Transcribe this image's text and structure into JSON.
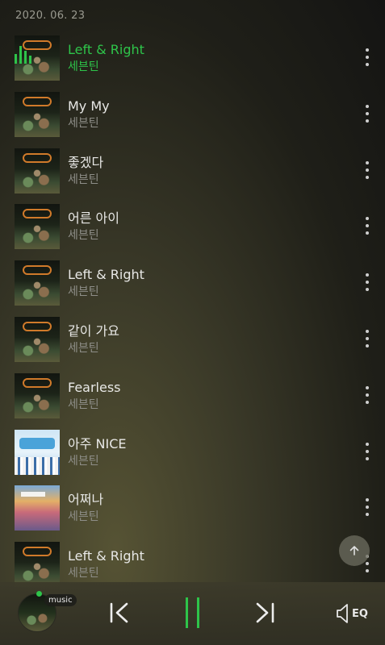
{
  "header": {
    "date": "2020. 06. 23"
  },
  "tracks": [
    {
      "title": "Left & Right",
      "artist": "세븐틴",
      "cover": "dark",
      "playing": true
    },
    {
      "title": "My My",
      "artist": "세븐틴",
      "cover": "dark",
      "playing": false
    },
    {
      "title": "좋겠다",
      "artist": "세븐틴",
      "cover": "dark",
      "playing": false
    },
    {
      "title": "어른 아이",
      "artist": "세븐틴",
      "cover": "dark",
      "playing": false
    },
    {
      "title": "Left & Right",
      "artist": "세븐틴",
      "cover": "dark",
      "playing": false
    },
    {
      "title": "같이 가요",
      "artist": "세븐틴",
      "cover": "dark",
      "playing": false
    },
    {
      "title": "Fearless",
      "artist": "세븐틴",
      "cover": "dark",
      "playing": false
    },
    {
      "title": "아주 NICE",
      "artist": "세븐틴",
      "cover": "sky",
      "playing": false
    },
    {
      "title": "어쩌나",
      "artist": "세븐틴",
      "cover": "colorful",
      "playing": false
    },
    {
      "title": "Left & Right",
      "artist": "세븐틴",
      "cover": "dark",
      "playing": false
    }
  ],
  "player": {
    "badge": "music",
    "eq_label": "EQ",
    "state": "playing"
  },
  "icons": {
    "more": "more-vertical-icon",
    "scroll_top": "arrow-up-icon",
    "prev": "skip-previous-icon",
    "pause": "pause-icon",
    "next": "skip-next-icon",
    "eq": "speaker-eq-icon",
    "playing": "equalizer-bars-icon"
  },
  "colors": {
    "accent": "#2ec44a"
  }
}
